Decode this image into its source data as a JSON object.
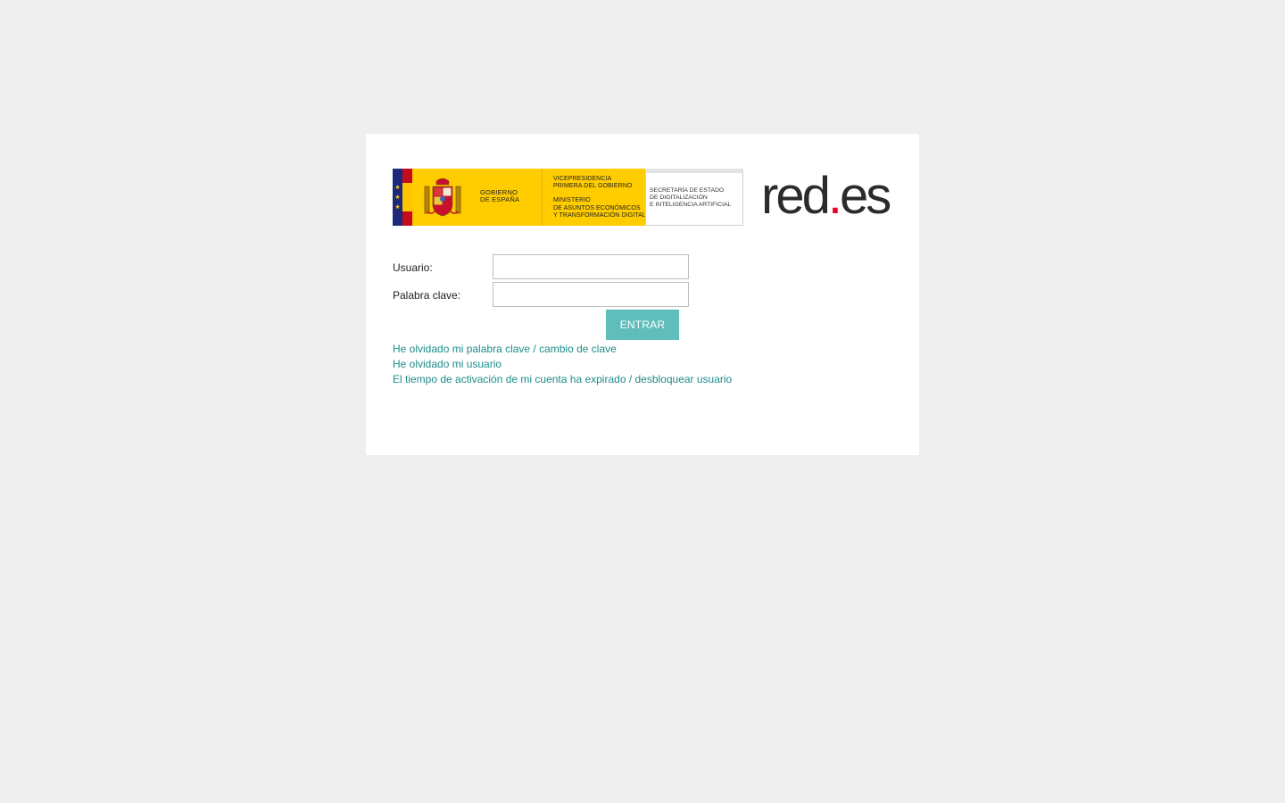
{
  "header": {
    "gobierno": [
      "GOBIERNO",
      "DE ESPAÑA"
    ],
    "ministry": {
      "vicepresidencia": [
        "VICEPRESIDENCIA",
        "PRIMERA DEL GOBIERNO"
      ],
      "ministerio": [
        "MINISTERIO",
        "DE ASUNTOS ECONÓMICOS",
        "Y TRANSFORMACIÓN DIGITAL"
      ]
    },
    "secretaria": [
      "SECRETARÍA DE ESTADO",
      "DE DIGITALIZACIÓN",
      "E INTELIGENCIA ARTIFICIAL"
    ],
    "brand": {
      "prefix": "red",
      "dot": ".",
      "suffix": "es",
      "dot_color": "#e4002b"
    }
  },
  "form": {
    "usuario_label": "Usuario:",
    "usuario_value": "",
    "password_label": "Palabra clave:",
    "password_value": "",
    "submit_label": "ENTRAR"
  },
  "links": {
    "forgot_password": "He olvidado mi palabra clave / cambio de clave",
    "forgot_user": "He olvidado mi usuario",
    "expired": "El tiempo de activación de mi cuenta ha expirado / desbloquear usuario"
  },
  "colors": {
    "background": "#efefef",
    "card": "#ffffff",
    "button": "#5fbdbc",
    "link": "#1d8d8a",
    "gov_yellow": "#ffcc00"
  }
}
